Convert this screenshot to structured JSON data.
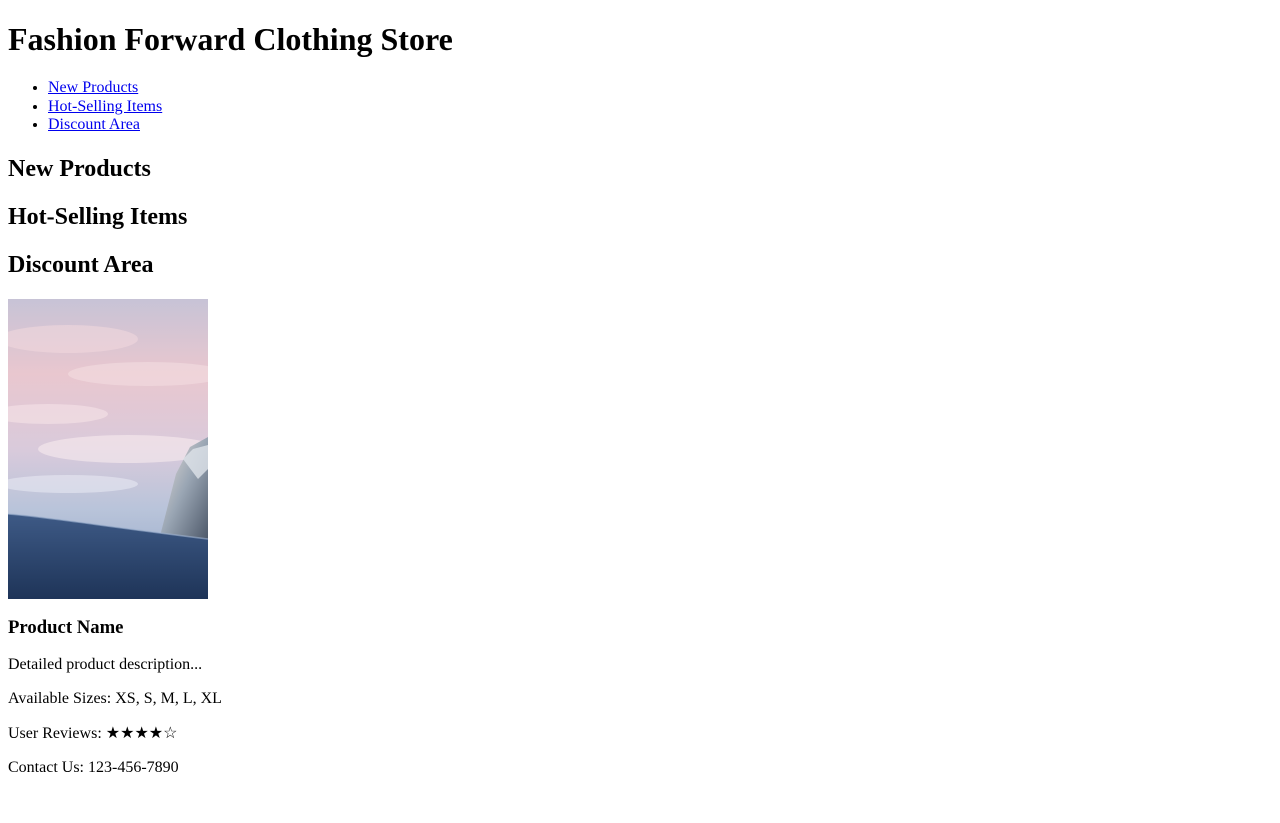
{
  "header": {
    "title": "Fashion Forward Clothing Store"
  },
  "nav": {
    "items": [
      {
        "label": "New Products"
      },
      {
        "label": "Hot-Selling Items"
      },
      {
        "label": "Discount Area"
      }
    ]
  },
  "sections": {
    "new_products": "New Products",
    "hot_selling": "Hot-Selling Items",
    "discount": "Discount Area"
  },
  "product": {
    "image_icon": "mountain-photo",
    "name": "Product Name",
    "description": "Detailed product description...",
    "sizes_label": "Available Sizes: ",
    "sizes": "XS, S, M, L, XL",
    "reviews_label": "User Reviews: ",
    "rating_stars": "★★★★☆",
    "rating_value": 4,
    "rating_max": 5,
    "contact_label": "Contact Us: ",
    "contact_phone": "123-456-7890"
  },
  "colors": {
    "link": "#0000ee",
    "text": "#000000",
    "background": "#ffffff"
  }
}
